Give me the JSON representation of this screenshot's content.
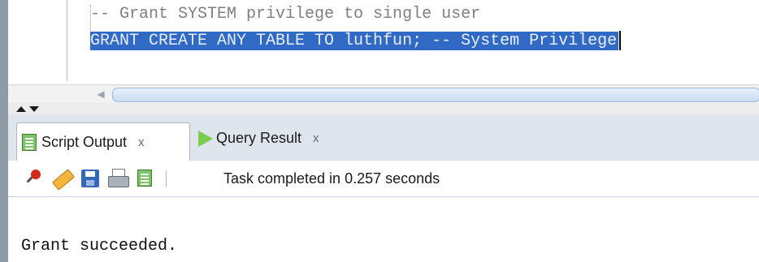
{
  "editor": {
    "line1": "-- Grant SYSTEM privilege to single user",
    "line2": "GRANT CREATE ANY TABLE TO luthfun; -- System Privilege"
  },
  "tabs": [
    {
      "label": "Script Output",
      "close": "x",
      "icon": "script-output-icon",
      "active": true
    },
    {
      "label": "Query Result",
      "close": "x",
      "icon": "run-icon",
      "active": false
    }
  ],
  "toolbar": {
    "icons": [
      "pin-icon",
      "eraser-icon",
      "save-icon",
      "print-icon",
      "script-icon"
    ],
    "status": "Task completed in 0.257 seconds"
  },
  "output": {
    "text": "Grant succeeded."
  },
  "colors": {
    "selection": "#316ac5",
    "tabbar": "#dfe5ec"
  }
}
